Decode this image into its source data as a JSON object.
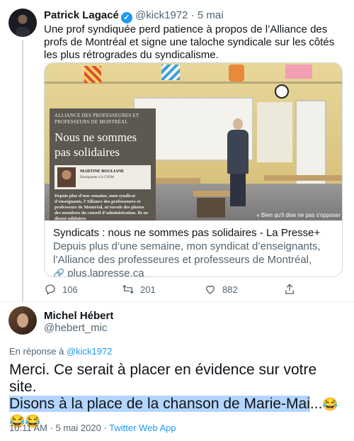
{
  "tweet": {
    "author_name": "Patrick Lagacé",
    "author_handle": "@kick1972",
    "separator": "·",
    "date": "5 mai",
    "text": "Une prof syndiquée perd patience à propos de l’Alliance des profs de Montréal et signe une taloche syndicale sur les côtés les plus rétrogrades du syndicalisme.",
    "card": {
      "image_overlay": {
        "org": "ALLIANCE DES PROFESSEURES ET PROFESSEURS DE MONTRÉAL",
        "title": "Nous ne sommes pas solidaires",
        "author_name": "MARTINE BOULIANE",
        "author_role": "Enseignante à la CSDM",
        "text": "Depuis plus d’une semaine, mon syndicat d’enseignants, l’Alliance des professeures et professeurs de Montréal, m’envoie des photos des membres du conseil d’administration. Ils ne disent solidaires"
      },
      "image_caption": "« Bien qu'il dise ne pas s'opposer",
      "title": "Syndicats : nous ne sommes pas solidaires - La Presse+",
      "description": "Depuis plus d’une semaine, mon syndicat d’enseignants, l’Alliance des professeures et professeurs de Montréal, m’envoie des photo...",
      "url": "plus.lapresse.ca"
    },
    "actions": {
      "replies": "106",
      "retweets": "201",
      "likes": "882"
    }
  },
  "reply": {
    "author_name": "Michel Hébert",
    "author_handle": "@hebert_mic",
    "replying_prefix": "En réponse à",
    "replying_handle": "@kick1972",
    "text_line1": "Merci. Ce serait à placer en évidence sur votre site.",
    "text_highlighted": "Disons à la place de la chanson de Marie-Mai",
    "text_ellipsis": "...",
    "emojis": "😂😂😂",
    "time": "10:11 AM · 5 mai 2020 · ",
    "app": "Twitter Web App"
  },
  "colors": {
    "accent": "#1d9bf0",
    "text_muted": "#536471",
    "highlight": "#b4d5fe"
  }
}
